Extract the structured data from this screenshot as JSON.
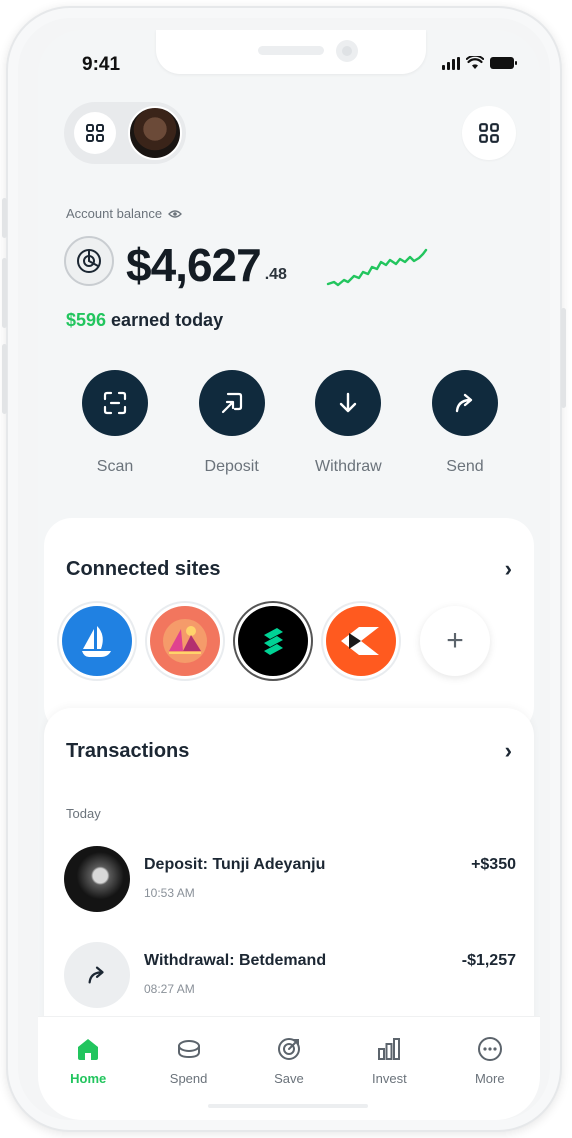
{
  "status_bar": {
    "time": "9:41"
  },
  "header": {
    "menu_icon": "grid-icon",
    "scan_icon": "qr-grid-icon"
  },
  "balance": {
    "label": "Account balance",
    "amount": "$4,627",
    "cents": ".48",
    "earned_amount": "$596",
    "earned_text": " earned today",
    "trend_color": "#22c55e"
  },
  "actions": [
    {
      "label": "Scan",
      "icon": "scan-icon"
    },
    {
      "label": "Deposit",
      "icon": "deposit-icon"
    },
    {
      "label": "Withdraw",
      "icon": "arrow-down-icon"
    },
    {
      "label": "Send",
      "icon": "share-arrow-icon"
    }
  ],
  "connected_sites": {
    "title": "Connected sites",
    "add_label": "+",
    "sites": [
      {
        "name": "opensea",
        "color": "#2081e2"
      },
      {
        "name": "mintable",
        "color": "#f2765e"
      },
      {
        "name": "compound",
        "color": "#00d395"
      },
      {
        "name": "fire-play",
        "color": "#ff5a1f"
      }
    ]
  },
  "transactions": {
    "title": "Transactions",
    "group": "Today",
    "items": [
      {
        "title": "Deposit: Tunji Adeyanju",
        "time": "10:53 AM",
        "amount": "+$350"
      },
      {
        "title": "Withdrawal: Betdemand",
        "time": "08:27 AM",
        "amount": "-$1,257"
      }
    ]
  },
  "tabbar": {
    "items": [
      {
        "label": "Home",
        "icon": "home-icon",
        "active": true
      },
      {
        "label": "Spend",
        "icon": "coin-stack-icon",
        "active": false
      },
      {
        "label": "Save",
        "icon": "target-icon",
        "active": false
      },
      {
        "label": "Invest",
        "icon": "bar-chart-icon",
        "active": false
      },
      {
        "label": "More",
        "icon": "more-icon",
        "active": false
      }
    ]
  },
  "colors": {
    "accent": "#22c55e",
    "primary_dark": "#102a3d"
  }
}
